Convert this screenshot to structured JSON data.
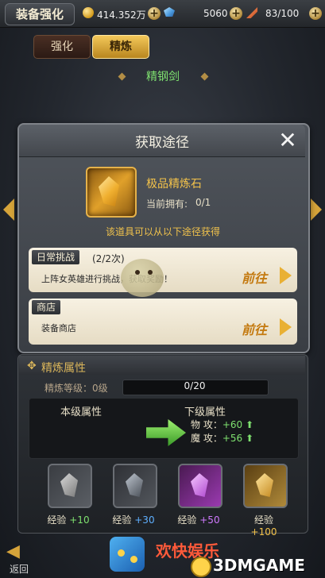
{
  "header": {
    "title": "装备强化",
    "gold": "414.352万",
    "gems": "5060",
    "stamina": "83/100"
  },
  "tabs": [
    {
      "label": "强化",
      "active": false
    },
    {
      "label": "精炼",
      "active": true
    }
  ],
  "equipment_name": "精钢剑",
  "modal": {
    "title": "获取途径",
    "item_name": "极品精炼石",
    "owned_label": "当前拥有:",
    "owned_value": "0/1",
    "hint": "该道具可以从以下途径获得",
    "sources": [
      {
        "tag": "日常挑战",
        "count": "(2/2次)",
        "desc": "上阵女英雄进行挑战，获取奖励！",
        "button": "前往"
      },
      {
        "tag": "商店",
        "count": "",
        "desc": "装备商店",
        "button": "前往"
      }
    ]
  },
  "refine": {
    "title": "精炼属性",
    "level_label": "精炼等级：0级",
    "progress_text": "0/20",
    "progress": 0,
    "current_label": "本级属性",
    "next_label": "下级属性",
    "next_stats": [
      {
        "name": "物  攻：",
        "value": "+60"
      },
      {
        "name": "魔  攻：",
        "value": "+56"
      }
    ],
    "materials": [
      {
        "label": "经验",
        "exp": "+10"
      },
      {
        "label": "经验",
        "exp": "+30"
      },
      {
        "label": "经验",
        "exp": "+50"
      },
      {
        "label": "经验",
        "exp": "+100"
      }
    ]
  },
  "footer": {
    "back_label": "返回",
    "watermark_text": "欢快娱乐",
    "watermark_logo": "3DMGAME"
  },
  "colors": {
    "accent_gold": "#f3c24a",
    "green": "#7ee06f"
  }
}
